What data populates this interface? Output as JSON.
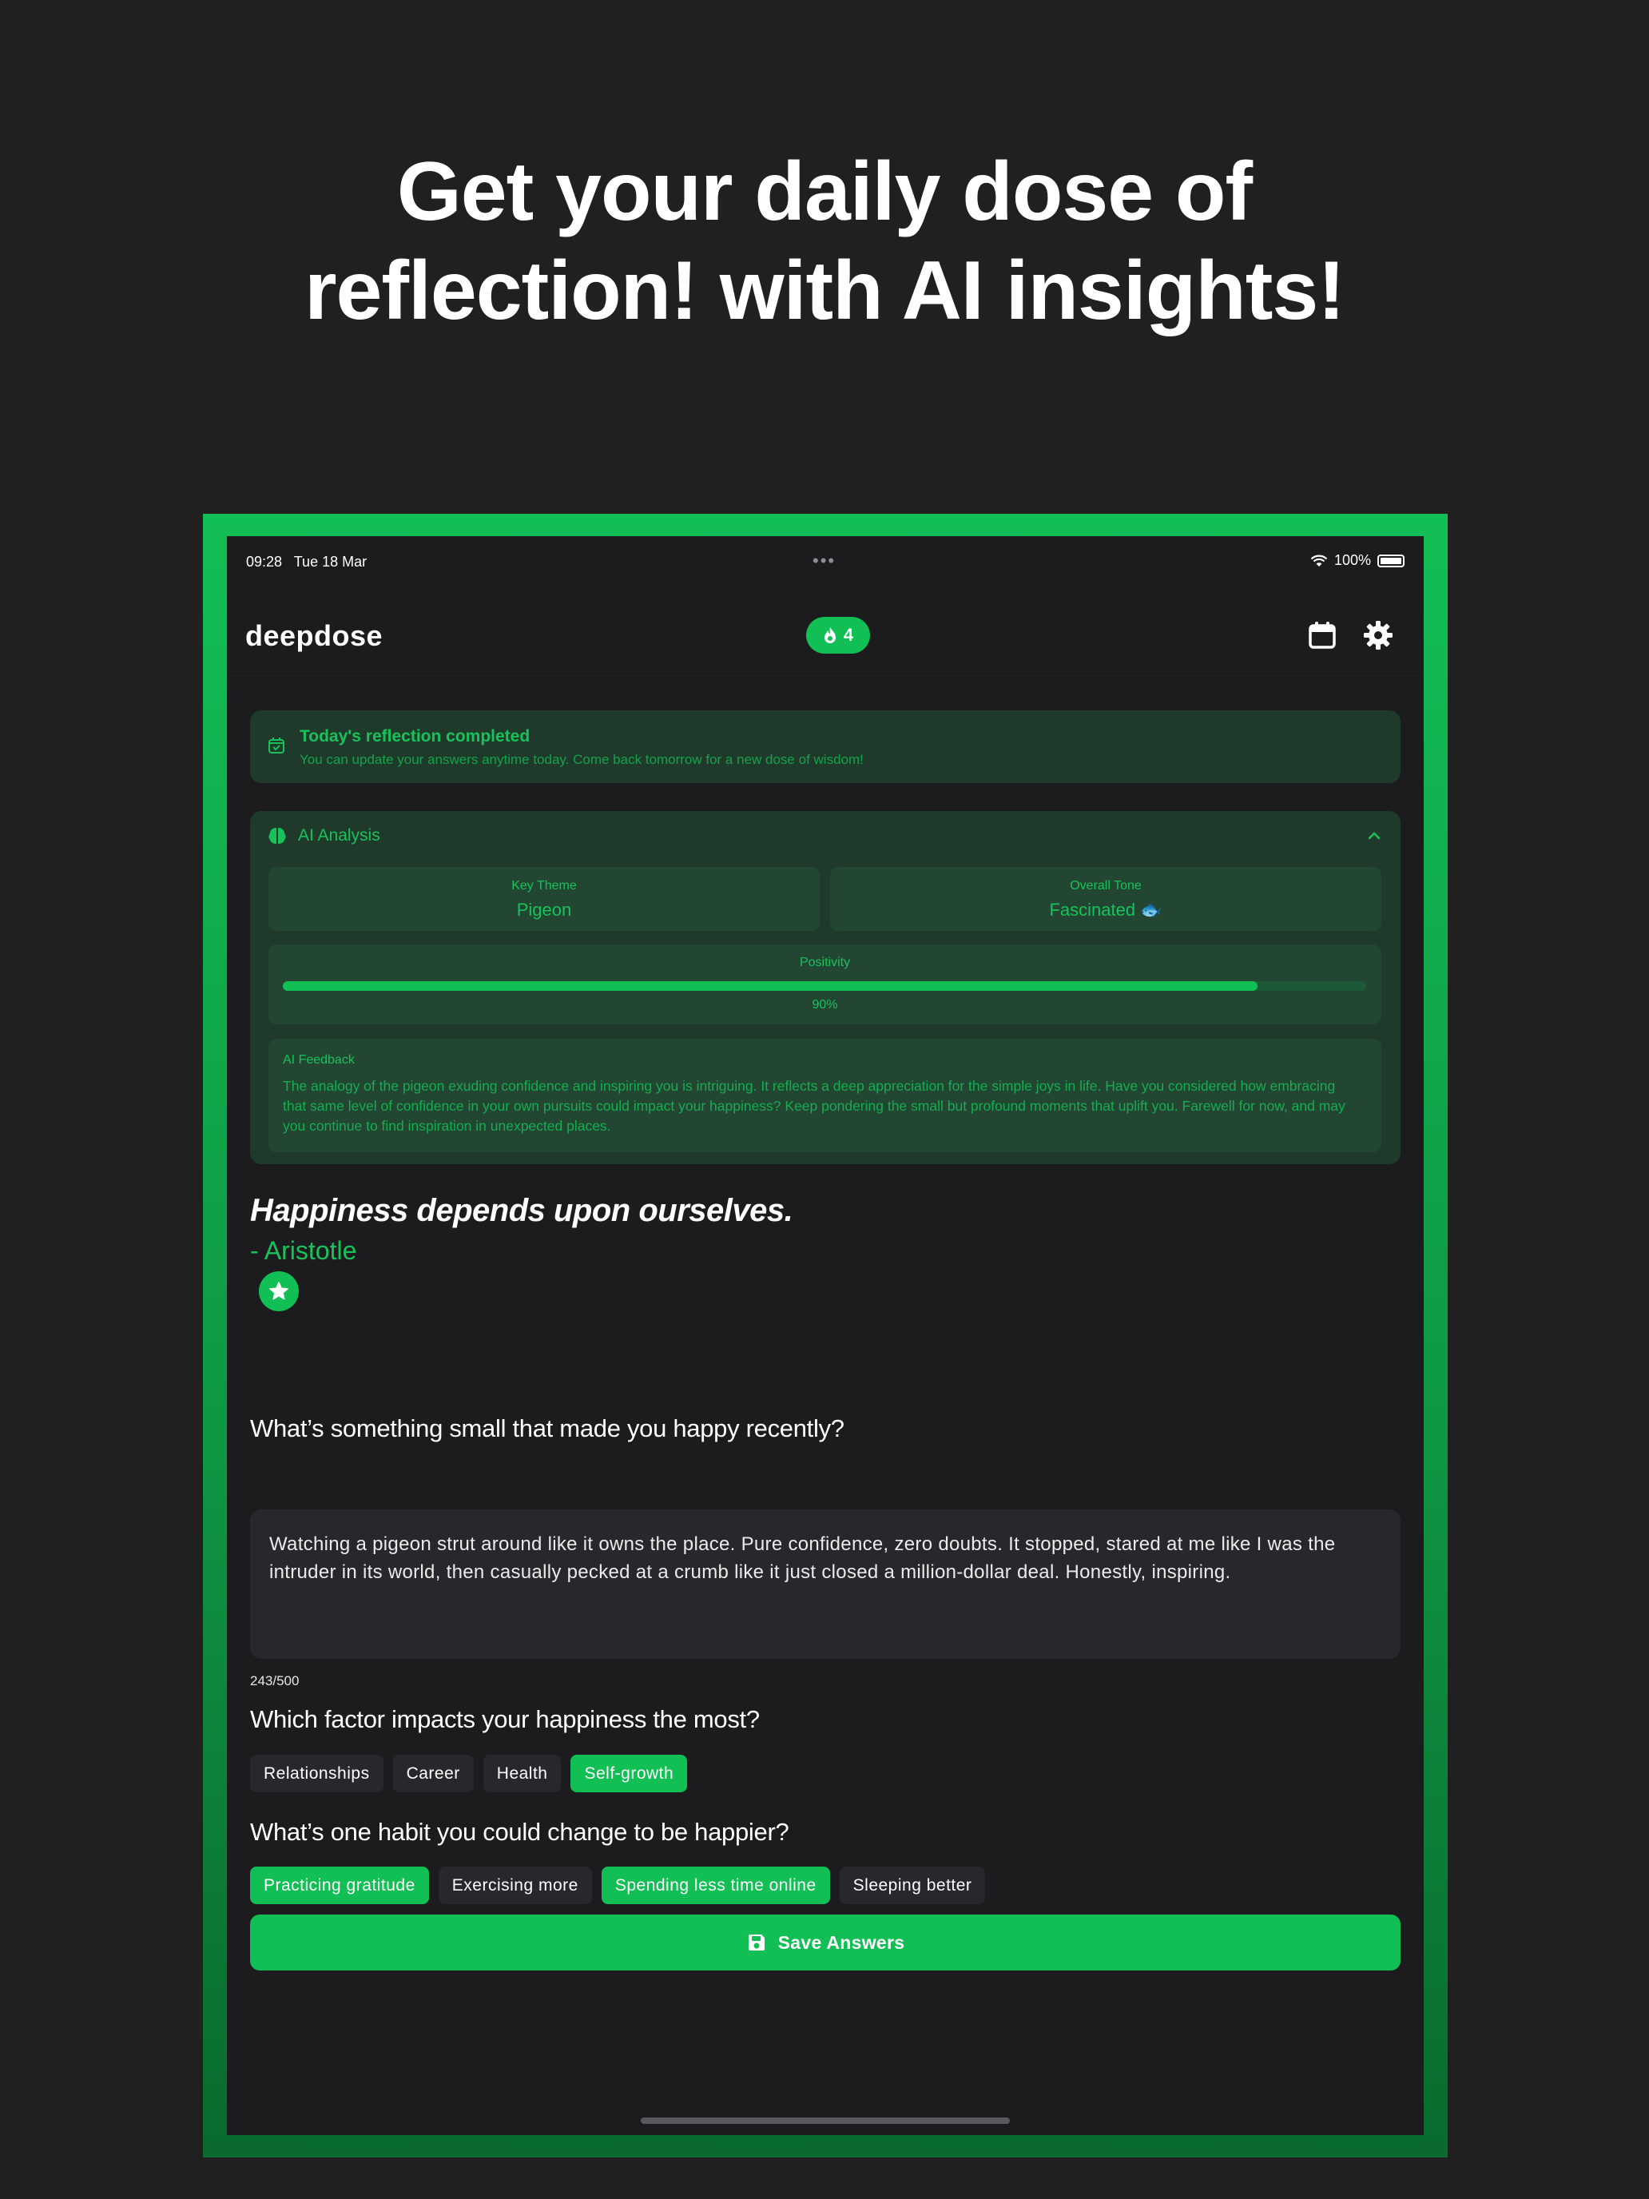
{
  "headline": {
    "line1": "Get your daily dose of",
    "line2": "reflection! with AI insights!"
  },
  "status_bar": {
    "time": "09:28",
    "date": "Tue 18 Mar",
    "battery": "100%"
  },
  "header": {
    "app_title": "deepdose",
    "streak_count": "4"
  },
  "completed_card": {
    "title": "Today's reflection completed",
    "subtitle": "You can update your answers anytime today. Come back tomorrow for a new dose of wisdom!"
  },
  "ai_analysis": {
    "title": "AI Analysis",
    "key_theme_label": "Key Theme",
    "key_theme_value": "Pigeon",
    "overall_tone_label": "Overall Tone",
    "overall_tone_value": "Fascinated 🐟",
    "positivity_label": "Positivity",
    "positivity_value": "90%",
    "positivity_fraction": 0.9,
    "feedback_label": "AI Feedback",
    "feedback_text": "The analogy of the pigeon exuding confidence and inspiring you is intriguing. It reflects a deep appreciation for the simple joys in life. Have you considered how embracing that same level of confidence in your own pursuits could impact your happiness? Keep pondering the small but profound moments that uplift you. Farewell for now, and may you continue to find inspiration in unexpected places."
  },
  "quote": {
    "text": "Happiness depends upon ourselves.",
    "author": "- Aristotle"
  },
  "question1": {
    "text": "What’s something small that made you happy recently?",
    "answer": "Watching a pigeon strut around like it owns the place. Pure confidence, zero doubts. It stopped, stared at me like I was the intruder in its world, then casually pecked at a crumb like it just closed a million-dollar deal. Honestly, inspiring.",
    "counter": "243/500"
  },
  "question2": {
    "text": "Which factor impacts your happiness the most?",
    "options": [
      "Relationships",
      "Career",
      "Health",
      "Self-growth"
    ]
  },
  "question3": {
    "text": "What’s one habit you could change to be happier?",
    "options": [
      "Practicing gratitude",
      "Exercising more",
      "Spending less time online",
      "Sleeping better"
    ]
  },
  "save_button": {
    "label": "Save Answers"
  },
  "colors": {
    "accent": "#12bf55",
    "background": "#1c1c1e",
    "card": "#1f3a2b"
  }
}
